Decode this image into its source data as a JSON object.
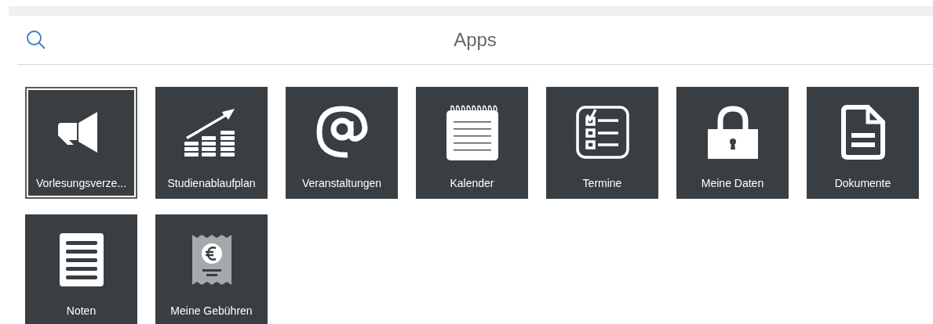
{
  "header": {
    "title": "Apps"
  },
  "tiles": [
    {
      "label": "Vorlesungsverze...",
      "kind": "megaphone",
      "selected": true
    },
    {
      "label": "Studienablaufplan",
      "kind": "chart",
      "selected": false
    },
    {
      "label": "Veranstaltungen",
      "kind": "at",
      "selected": false
    },
    {
      "label": "Kalender",
      "kind": "notepad",
      "selected": false
    },
    {
      "label": "Termine",
      "kind": "checklist",
      "selected": false
    },
    {
      "label": "Meine Daten",
      "kind": "lock",
      "selected": false
    },
    {
      "label": "Dokumente",
      "kind": "document",
      "selected": false
    },
    {
      "label": "Noten",
      "kind": "list",
      "selected": false
    },
    {
      "label": "Meine Gebühren",
      "kind": "receipt",
      "selected": false
    }
  ]
}
